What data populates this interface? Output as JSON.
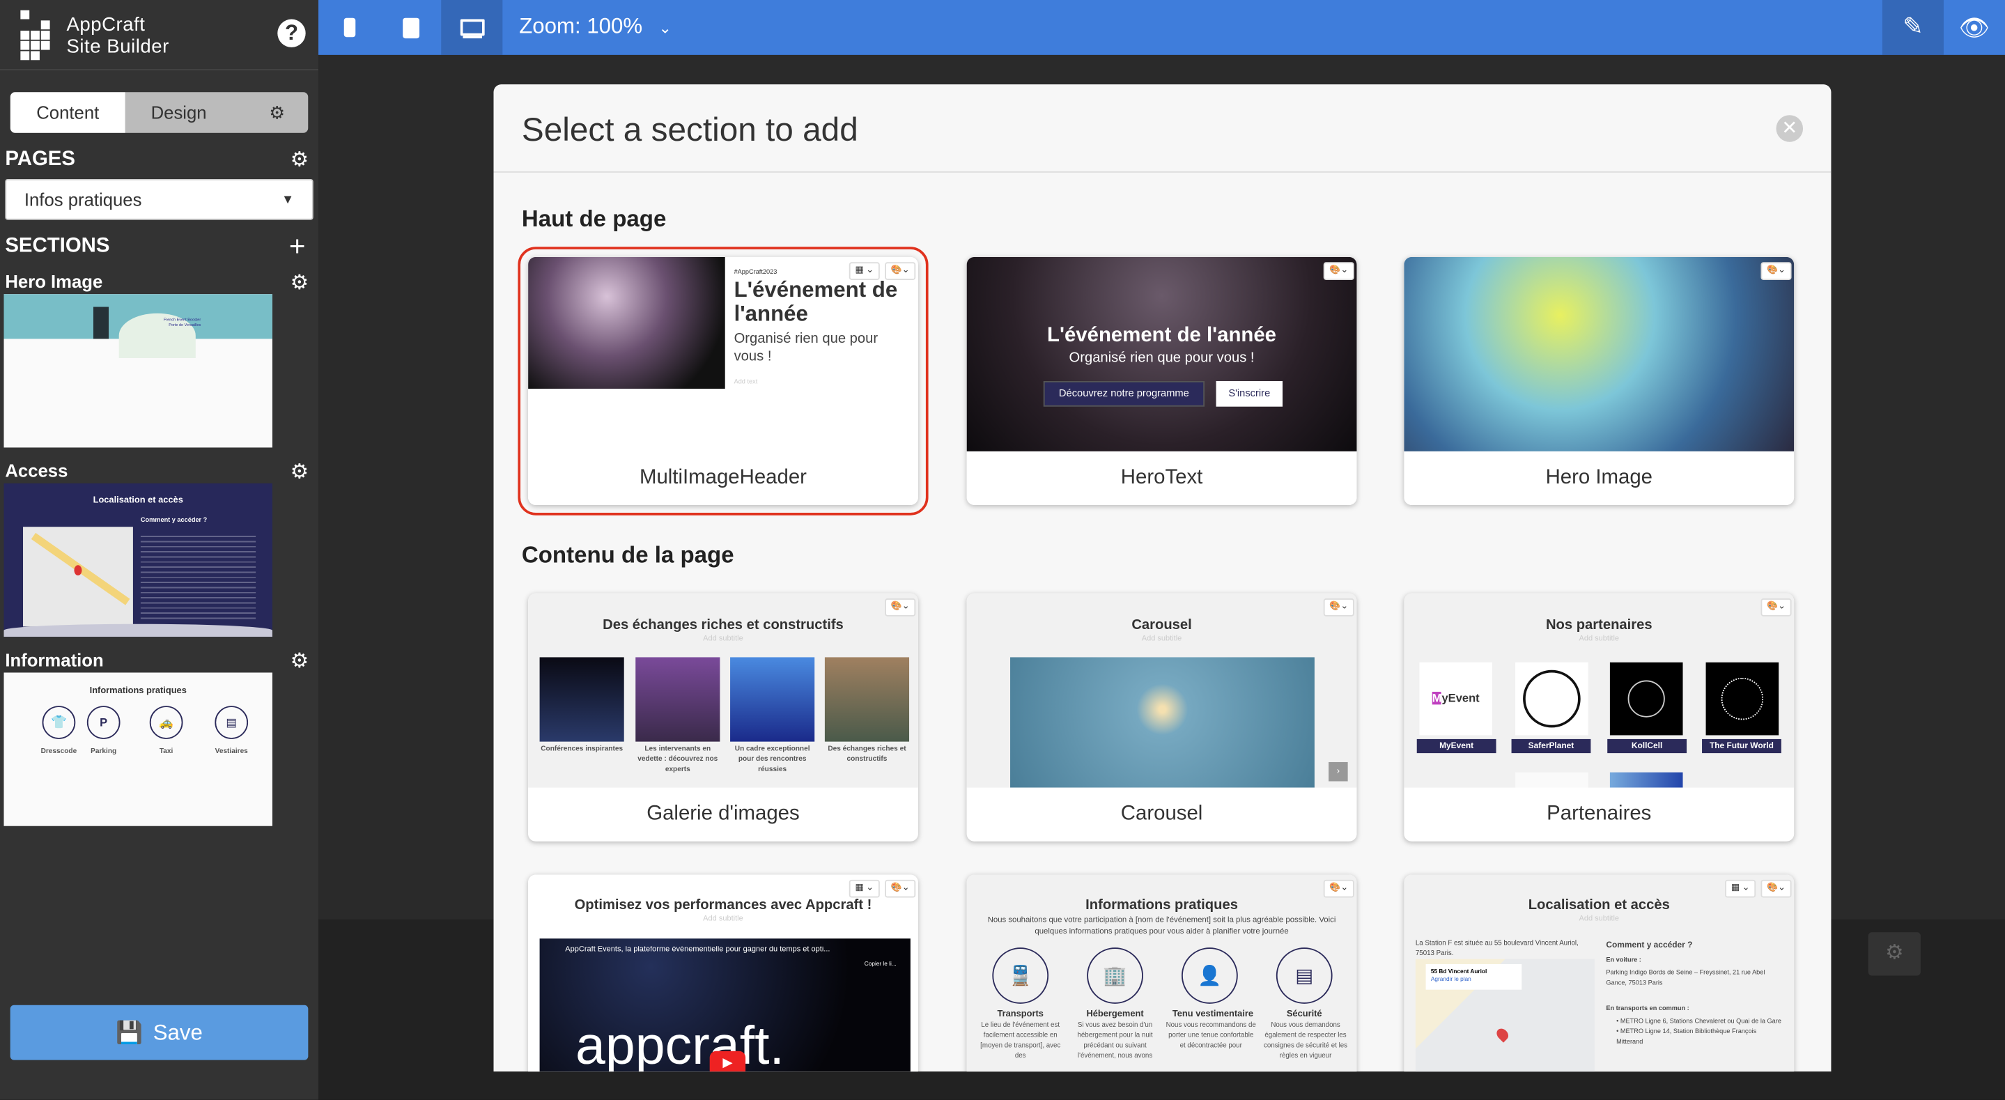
{
  "app": {
    "brand_line1": "AppCraft",
    "brand_line2": "Site Builder"
  },
  "sidebar": {
    "tabs": {
      "content": "Content",
      "design": "Design"
    },
    "pages_header": "PAGES",
    "page_select": "Infos pratiques",
    "sections_header": "SECTIONS",
    "sections": [
      {
        "label": "Hero Image",
        "preview_text": [
          "French Event Booster",
          "Porte de Versailles"
        ]
      },
      {
        "label": "Access",
        "preview_title": "Localisation et accès",
        "preview_subtitle": "Comment y accéder ?"
      },
      {
        "label": "Information",
        "preview_title": "Informations pratiques",
        "items": [
          "Dresscode",
          "Parking",
          "Taxi",
          "Vestiaires"
        ]
      }
    ],
    "save_label": "Save"
  },
  "topbar": {
    "zoom_label": "Zoom: 100%"
  },
  "modal": {
    "title": "Select a section to add",
    "groups": [
      {
        "title": "Haut de page"
      },
      {
        "title": "Contenu de la page"
      }
    ],
    "cards": {
      "multi": {
        "name": "MultiImageHeader",
        "tag": "#AppCraft2023",
        "title": "L'événement de l'année",
        "subtitle": "Organisé rien que pour vous !",
        "add_text": "Add text"
      },
      "herotext": {
        "name": "HeroText",
        "title": "L'événement de l'année",
        "subtitle": "Organisé rien que pour vous !",
        "btn1": "Découvrez notre programme",
        "btn2": "S'inscrire"
      },
      "heroimage": {
        "name": "Hero Image"
      },
      "gallery": {
        "name": "Galerie d'images",
        "title": "Des échanges riches et constructifs",
        "subtitle": "Add subtitle",
        "captions": [
          "Conférences inspirantes",
          "Les intervenants en vedette : découvrez nos experts",
          "Un cadre exceptionnel pour des rencontres réussies",
          "Des échanges riches et constructifs"
        ]
      },
      "carousel": {
        "name": "Carousel",
        "title": "Carousel",
        "subtitle": "Add subtitle"
      },
      "partners": {
        "name": "Partenaires",
        "title": "Nos partenaires",
        "subtitle": "Add subtitle",
        "logos": [
          "MyEvent",
          "SaferPlanet",
          "KollCell",
          "The Futur World"
        ]
      },
      "video": {
        "title": "Optimisez vos performances avec Appcraft !",
        "subtitle": "Add subtitle",
        "video_title": "AppCraft Events, la plateforme événementielle pour gagner du temps et opti...",
        "copy": "Copier le li...",
        "logo": "appcraft."
      },
      "infos": {
        "title": "Informations pratiques",
        "intro": "Nous souhaitons que votre participation à [nom de l'événement] soit la plus agréable possible. Voici quelques informations pratiques pour vous aider à planifier votre journée",
        "items": [
          {
            "t": "Transports",
            "d": "Le lieu de l'événement est facilement accessible en [moyen de transport], avec des"
          },
          {
            "t": "Hébergement",
            "d": "Si vous avez besoin d'un hébergement pour la nuit précédant ou suivant l'événement, nous avons"
          },
          {
            "t": "Tenu vestimentaire",
            "d": "Nous vous recommandons de porter une tenue confortable et décontractée pour"
          },
          {
            "t": "Sécurité",
            "d": "Nous vous demandons également de respecter les consignes de sécurité et les règles en vigueur"
          }
        ]
      },
      "location": {
        "title": "Localisation et accès",
        "subtitle": "Add subtitle",
        "address": "La Station F est située au 55 boulevard Vincent Auriol, 75013 Paris.",
        "map_label": "55 Bd Vincent Auriol",
        "map_link": "Agrandir le plan",
        "how": "Comment y accéder ?",
        "car": "En voiture :",
        "car_addr": "Parking Indigo Bords de Seine – Freyssinet, 21 rue Abel Gance, 75013 Paris",
        "transit": "En transports en commun :",
        "lines": [
          "METRO Ligne 6, Stations Chevaleret ou Quai de la Gare",
          "METRO Ligne 14, Station Bibliothèque François Mitterand"
        ]
      }
    }
  },
  "colors": {
    "topbar": "#3f7ddb",
    "save": "#5a9be0",
    "selected_outline": "#e0321e",
    "navy": "#2b2a5a"
  }
}
